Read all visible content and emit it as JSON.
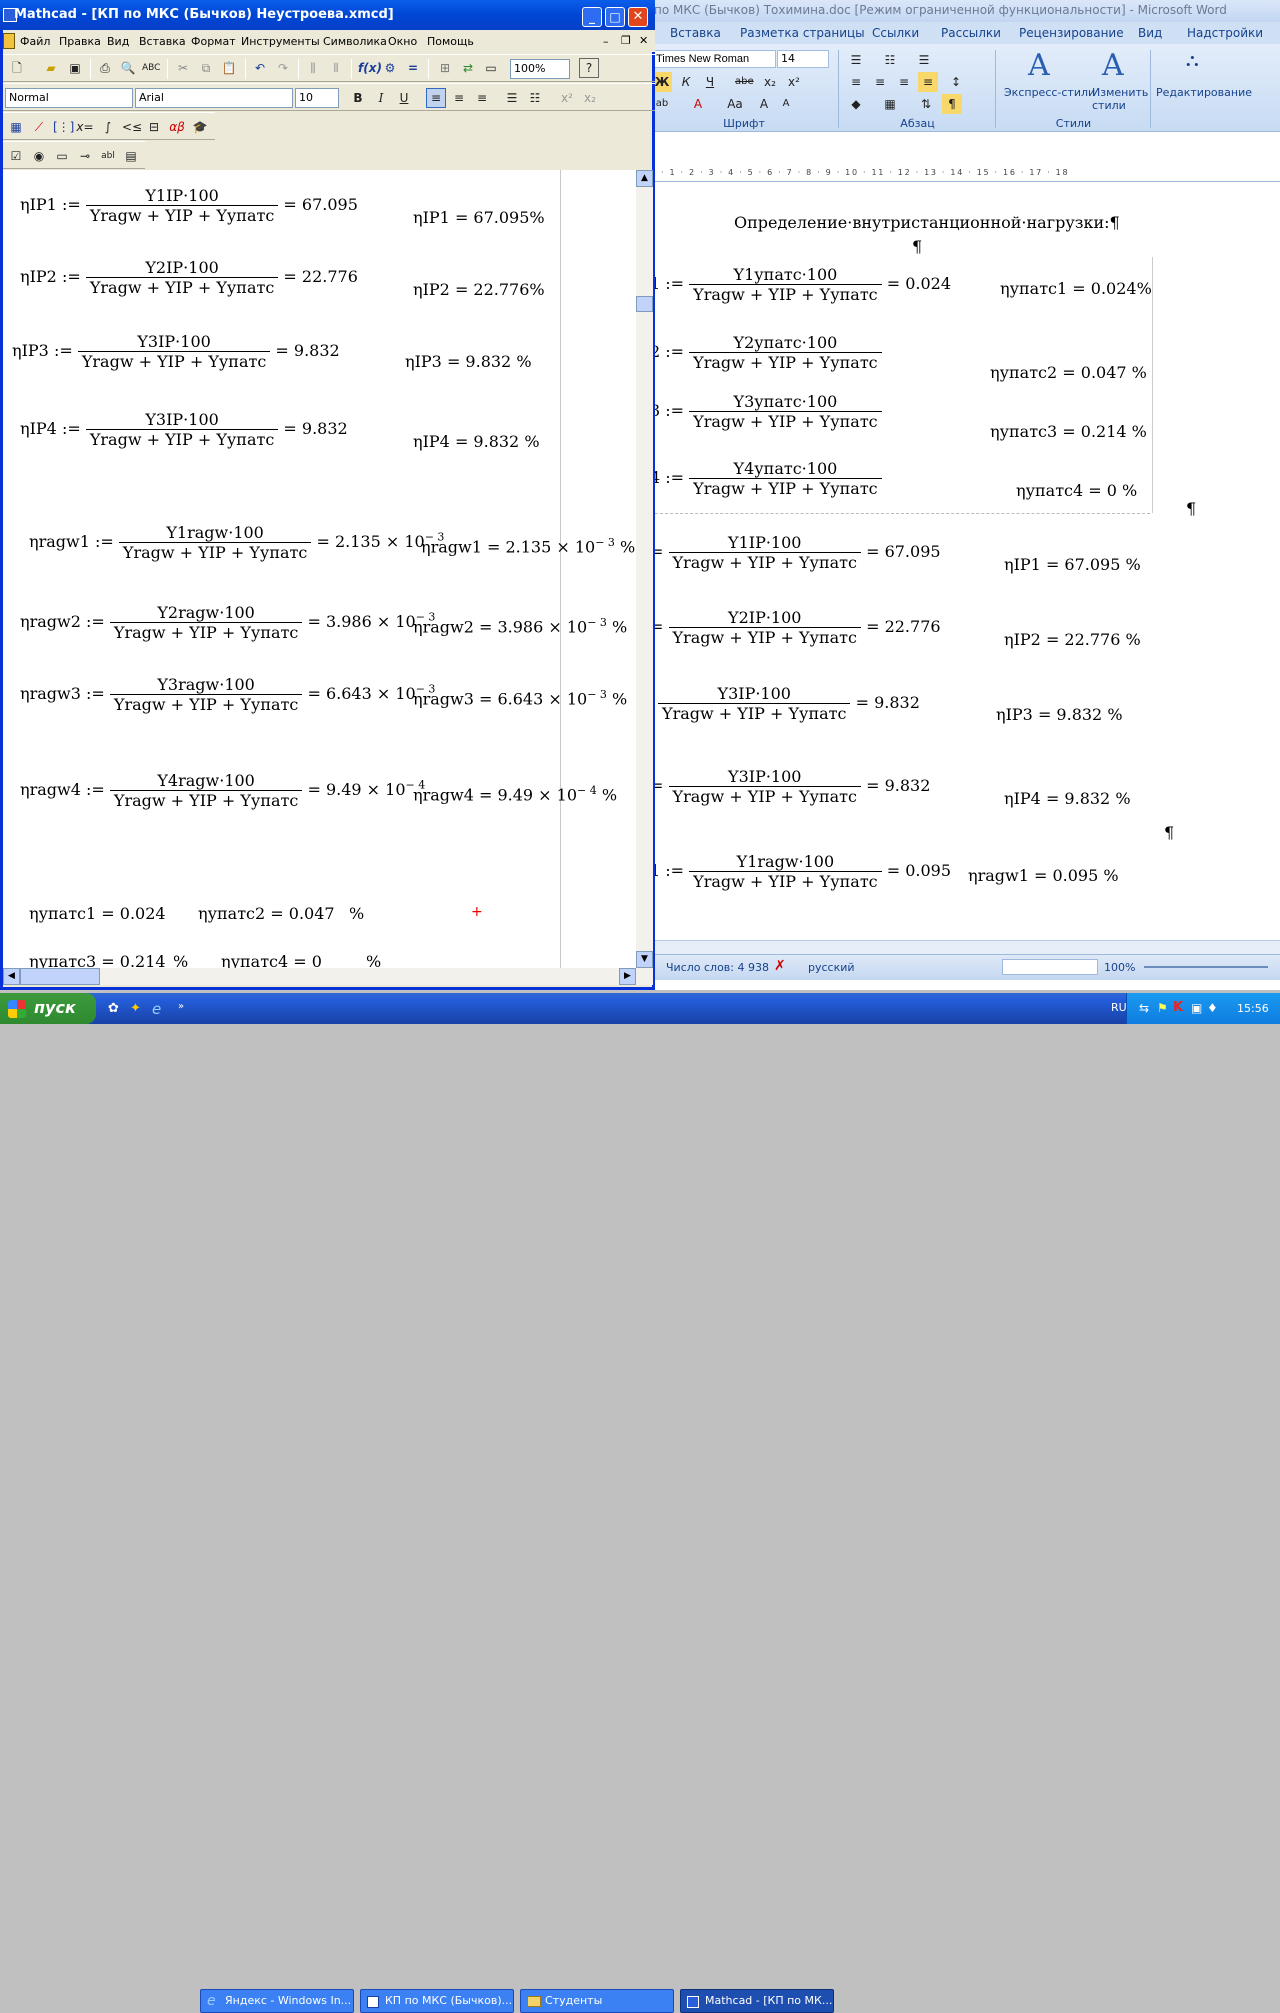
{
  "word": {
    "title": "по МКС (Бычков) Тохимина.doc [Режим ограниченной функциональности] - Microsoft Word",
    "tabs": [
      "Вставка",
      "Разметка страницы",
      "Ссылки",
      "Рассылки",
      "Рецензирование",
      "Вид",
      "Надстройки"
    ],
    "font_name": "Times New Roman",
    "font_size": "14",
    "groups": {
      "font": "Шрифт",
      "para": "Абзац",
      "styles": "Стили",
      "edit": "Редактирование"
    },
    "buttons": {
      "express_styles": "Экспресс-стили",
      "change_styles": "Изменить стили",
      "editing": "Редактирование"
    },
    "ruler": "2 · 1 · 2 · 3 · 4 · 5 · 6 · 7 · 8 · 9 · 10 · 11 · 12 · 13 · 14 · 15 · 16 · 17 · 18",
    "heading": "Определение·внутристанционной·нагрузки:¶",
    "pilcrow": "¶",
    "status": {
      "words": "Число слов: 4 938",
      "lang": "русский",
      "zoom": "100%"
    },
    "eqs": [
      {
        "lhs": "1 :=",
        "num": "Y1упатс·100",
        "den": "Yragw + YIP + Yупатс",
        "res": "= 0.024",
        "disp": "ηупатс1 = 0.024%"
      },
      {
        "lhs": "2 :=",
        "num": "Y2упатс·100",
        "den": "Yragw + YIP + Yупатс",
        "res": "",
        "disp": "ηупатс2 = 0.047 %"
      },
      {
        "lhs": "3 :=",
        "num": "Y3упатс·100",
        "den": "Yragw + YIP + Yупатс",
        "res": "",
        "disp": "ηупатс3 = 0.214 %"
      },
      {
        "lhs": "4 :=",
        "num": "Y4упатс·100",
        "den": "Yragw + YIP + Yупатс",
        "res": "",
        "disp": "ηупатс4 = 0 %"
      },
      {
        "lhs": "=",
        "num": "Y1IP·100",
        "den": "Yragw + YIP + Yупатс",
        "res": "= 67.095",
        "disp": "ηIP1 = 67.095 %"
      },
      {
        "lhs": "=",
        "num": "Y2IP·100",
        "den": "Yragw + YIP + Yупатс",
        "res": "= 22.776",
        "disp": "ηIP2 = 22.776 %"
      },
      {
        "lhs": "",
        "num": "Y3IP·100",
        "den": "Yragw + YIP + Yупатс",
        "res": "= 9.832",
        "disp": "ηIP3 = 9.832 %"
      },
      {
        "lhs": "=",
        "num": "Y3IP·100",
        "den": "Yragw + YIP + Yупатс",
        "res": "= 9.832",
        "disp": "ηIP4 = 9.832 %"
      },
      {
        "lhs": "1 :=",
        "num": "Y1ragw·100",
        "den": "Yragw + YIP + Yупатс",
        "res": "= 0.095",
        "disp": "ηragw1 = 0.095 %"
      }
    ]
  },
  "mathcad": {
    "title": "Mathcad - [КП по МКС (Бычков) Неустроева.xmcd]",
    "menu": [
      "Файл",
      "Правка",
      "Вид",
      "Вставка",
      "Формат",
      "Инструменты",
      "Символика",
      "Окно",
      "Помощь"
    ],
    "zoom": "100%",
    "style": "Normal",
    "font": "Arial",
    "size": "10",
    "eqs": [
      {
        "lhs": "ηIP1 :=",
        "num": "Y1IP·100",
        "den": "Yragw + YIP + Yупатс",
        "res": "= 67.095",
        "disp": "ηIP1 = 67.095%"
      },
      {
        "lhs": "ηIP2 :=",
        "num": "Y2IP·100",
        "den": "Yragw + YIP + Yупатс",
        "res": "= 22.776",
        "disp": "ηIP2 = 22.776%"
      },
      {
        "lhs": "ηIP3 :=",
        "num": "Y3IP·100",
        "den": "Yragw + YIP + Yупатс",
        "res": "= 9.832",
        "disp": "ηIP3 = 9.832 %"
      },
      {
        "lhs": "ηIP4 :=",
        "num": "Y3IP·100",
        "den": "Yragw + YIP + Yупатс",
        "res": "= 9.832",
        "disp": "ηIP4 = 9.832 %"
      },
      {
        "lhs": "ηragw1 :=",
        "num": "Y1ragw·100",
        "den": "Yragw + YIP + Yупатс",
        "res": "= 2.135 × 10",
        "exp": "− 3",
        "disp": "ηragw1 = 2.135 × 10",
        "dexp": "− 3",
        "dunit": "%"
      },
      {
        "lhs": "ηragw2 :=",
        "num": "Y2ragw·100",
        "den": "Yragw + YIP + Yупатс",
        "res": "= 3.986 × 10",
        "exp": "− 3",
        "disp": "ηragw2 = 3.986 × 10",
        "dexp": "− 3",
        "dunit": "%"
      },
      {
        "lhs": "ηragw3 :=",
        "num": "Y3ragw·100",
        "den": "Yragw + YIP + Yупатс",
        "res": "= 6.643 × 10",
        "exp": "− 3",
        "disp": "ηragw3 = 6.643 × 10",
        "dexp": "− 3",
        "dunit": "%"
      },
      {
        "lhs": "ηragw4 :=",
        "num": "Y4ragw·100",
        "den": "Yragw + YIP + Yупатс",
        "res": "= 9.49 × 10",
        "exp": "− 4",
        "disp": "ηragw4 = 9.49 × 10",
        "dexp": "− 4",
        "dunit": "%"
      }
    ],
    "bottom": [
      {
        "text": "ηупатс1 = 0.024"
      },
      {
        "text": "ηупатс2 = 0.047"
      },
      {
        "text": "%"
      },
      {
        "text": "ηупатс3 = 0.214"
      },
      {
        "text": "%"
      },
      {
        "text": "ηупатс4 = 0"
      },
      {
        "text": "%"
      }
    ]
  },
  "taskbar": {
    "start": "пуск",
    "items": [
      "Яндекс - Windows In...",
      "КП по МКС (Бычков)...",
      "Студенты",
      "Mathcad - [КП по МК..."
    ],
    "lang": "RU",
    "clock": "15:56"
  }
}
